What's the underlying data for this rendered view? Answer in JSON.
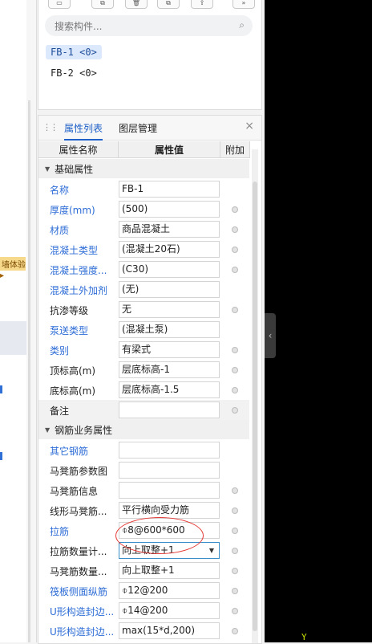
{
  "left_panel": {
    "tag_text": "墙体验",
    "arrow": "▸"
  },
  "top_toolbar": {
    "icons": [
      "new-icon",
      "copy-icon",
      "delete-icon",
      "layer-copy-icon",
      "extract-icon",
      "more-icon"
    ]
  },
  "search": {
    "placeholder": "搜索构件...",
    "icon": "search-icon"
  },
  "components": [
    "FB-1 <0>",
    "FB-2 <0>"
  ],
  "selected_component": "FB-1 <0>",
  "property_panel": {
    "tabs": [
      "属性列表",
      "图层管理"
    ],
    "active_tab": "属性列表",
    "columns": [
      "属性名称",
      "属性值",
      "附加"
    ],
    "groups": [
      {
        "title": "基础属性",
        "rows": [
          {
            "name": "名称",
            "value": "FB-1",
            "blue": true,
            "dot": false
          },
          {
            "name": "厚度(mm)",
            "value": "(500)",
            "blue": true,
            "dot": true
          },
          {
            "name": "材质",
            "value": "商品混凝土",
            "blue": true,
            "dot": true
          },
          {
            "name": "混凝土类型",
            "value": "(混凝土20石)",
            "blue": true,
            "dot": true
          },
          {
            "name": "混凝土强度...",
            "value": "(C30)",
            "blue": true,
            "dot": true
          },
          {
            "name": "混凝土外加剂",
            "value": "(无)",
            "blue": true,
            "dot": false
          },
          {
            "name": "抗渗等级",
            "value": "无",
            "blue": false,
            "dot": true
          },
          {
            "name": "泵送类型",
            "value": "(混凝土泵)",
            "blue": true,
            "dot": false
          },
          {
            "name": "类别",
            "value": "有梁式",
            "blue": true,
            "dot": true
          },
          {
            "name": "顶标高(m)",
            "value": "层底标高-1",
            "blue": false,
            "dot": true
          },
          {
            "name": "底标高(m)",
            "value": "层底标高-1.5",
            "blue": false,
            "dot": true
          },
          {
            "name": "备注",
            "value": "",
            "blue": false,
            "dot": true,
            "shaded": true
          }
        ]
      },
      {
        "title": "钢筋业务属性",
        "rows": [
          {
            "name": "其它钢筋",
            "value": "",
            "blue": true,
            "dot": false
          },
          {
            "name": "马凳筋参数图",
            "value": "",
            "blue": false,
            "dot": false
          },
          {
            "name": "马凳筋信息",
            "value": "",
            "blue": false,
            "dot": true
          },
          {
            "name": "线形马凳筋...",
            "value": "平行横向受力筋",
            "blue": false,
            "dot": true
          },
          {
            "name": "拉筋",
            "value": "⌽8@600*600",
            "blue": true,
            "dot": true
          },
          {
            "name": "拉筋数量计...",
            "value": "向上取整+1",
            "blue": false,
            "dot": true,
            "active": true,
            "dropdown": true
          },
          {
            "name": "马凳筋数量...",
            "value": "向上取整+1",
            "blue": false,
            "dot": true
          },
          {
            "name": "筏板侧面纵筋",
            "value": "⌽12@200",
            "blue": true,
            "dot": true
          },
          {
            "name": "U形构造封边...",
            "value": "⌽14@200",
            "blue": true,
            "dot": true
          },
          {
            "name": "U形构造封边...",
            "value": "max(15*d,200)",
            "blue": true,
            "dot": true
          }
        ]
      }
    ]
  },
  "canvas": {
    "axis_label": "Y"
  }
}
